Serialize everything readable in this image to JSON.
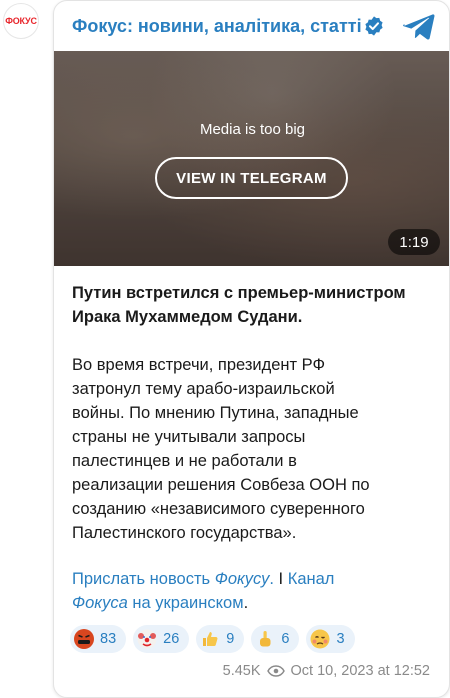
{
  "channel": {
    "avatar_text": "ФОКУС",
    "title": "Фокус: новини, аналітика, статті"
  },
  "media": {
    "notice": "Media is too big",
    "button_label": "VIEW IN TELEGRAM",
    "duration": "1:19"
  },
  "post": {
    "headline_line1": "Путин встретился с премьер-министром",
    "headline_line2": "Ирака Мухаммедом Судани.",
    "paragraph": [
      "Во время встречи, президент РФ",
      "затронул тему арабо-израильской",
      "войны. По мнению Путина, западные",
      "страны не учитывали запросы",
      "палестинцев и не работали в",
      "реализации решения Совбеза ООН по",
      "созданию «независимого суверенного",
      "Палестинского государства»."
    ],
    "links": {
      "part1": "Прислать новость ",
      "part2": "Фокусу",
      "part3": ".",
      "separator": " I ",
      "part4": "Канал",
      "part5": "Фокуса",
      "part6": " на украинском",
      "part7": "."
    }
  },
  "reactions": [
    {
      "icon": "angry-face-icon",
      "count": "83"
    },
    {
      "icon": "clown-face-icon",
      "count": "26"
    },
    {
      "icon": "thumbs-up-icon",
      "count": "9"
    },
    {
      "icon": "middle-finger-icon",
      "count": "6"
    },
    {
      "icon": "woozy-face-icon",
      "count": "3"
    }
  ],
  "meta": {
    "views": "5.45K",
    "date": "Oct 10, 2023 at 12:52"
  },
  "colors": {
    "accent": "#2a7fc0",
    "brand_red": "#e8262c",
    "reaction_bg": "#eaf2fa"
  }
}
